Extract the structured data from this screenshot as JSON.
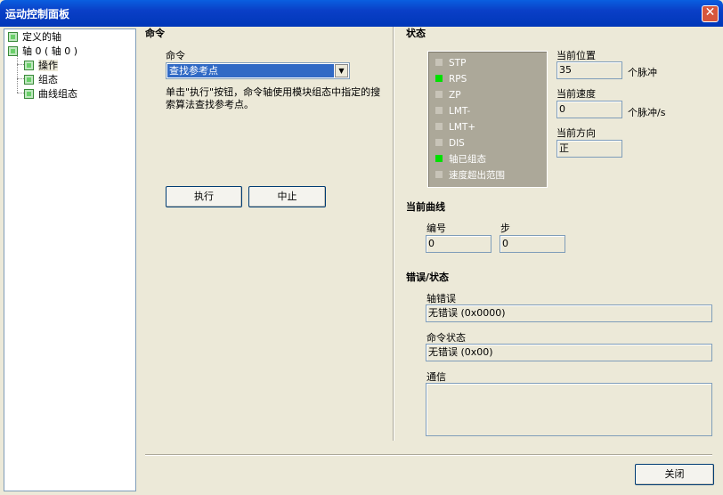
{
  "window": {
    "title": "运动控制面板",
    "close_glyph": "✕"
  },
  "tree": {
    "items": [
      {
        "label": "定义的轴"
      },
      {
        "label": "轴 0 ( 轴 0 )"
      },
      {
        "label": "操作"
      },
      {
        "label": "组态"
      },
      {
        "label": "曲线组态"
      }
    ]
  },
  "command": {
    "section_title": "命令",
    "select_label": "命令",
    "selected_value": "查找参考点",
    "description": "单击\"执行\"按钮，命令轴使用模块组态中指定的搜索算法查找参考点。",
    "execute_label": "执行",
    "abort_label": "中止"
  },
  "status": {
    "section_title": "状态",
    "indicators": [
      {
        "label": "STP",
        "color": "#c8c4b8"
      },
      {
        "label": "RPS",
        "color": "#00e000"
      },
      {
        "label": "ZP",
        "color": "#c8c4b8"
      },
      {
        "label": "LMT-",
        "color": "#c8c4b8"
      },
      {
        "label": "LMT+",
        "color": "#c8c4b8"
      },
      {
        "label": "DIS",
        "color": "#c8c4b8"
      },
      {
        "label": "轴已组态",
        "color": "#00e000"
      },
      {
        "label": "速度超出范围",
        "color": "#c8c4b8"
      }
    ],
    "position_label": "当前位置",
    "position_value": "35",
    "position_unit": "个脉冲",
    "speed_label": "当前速度",
    "speed_value": "0",
    "speed_unit": "个脉冲/s",
    "direction_label": "当前方向",
    "direction_value": "正"
  },
  "curve": {
    "section_title": "当前曲线",
    "number_label": "编号",
    "number_value": "0",
    "step_label": "步",
    "step_value": "0"
  },
  "errors": {
    "section_title": "错误/状态",
    "axis_error_label": "轴错误",
    "axis_error_value": "无错误 (0x0000)",
    "cmd_status_label": "命令状态",
    "cmd_status_value": "无错误 (0x00)",
    "comm_label": "通信",
    "comm_value": ""
  },
  "footer": {
    "close_label": "关闭"
  }
}
